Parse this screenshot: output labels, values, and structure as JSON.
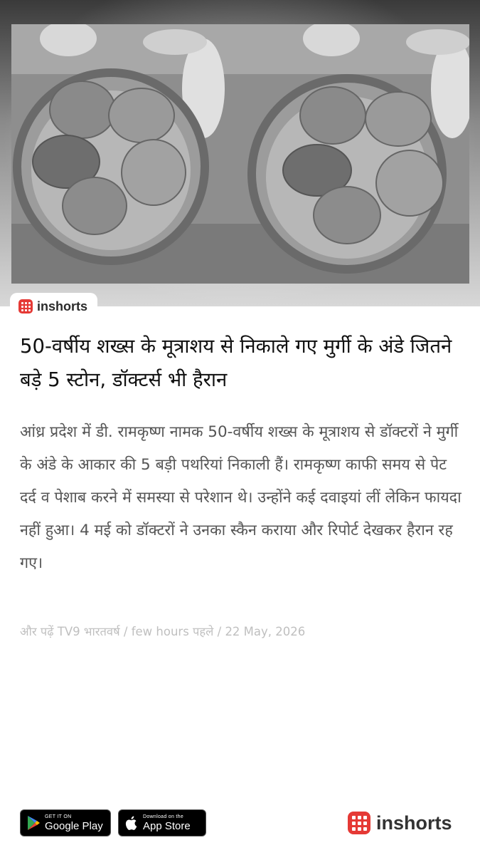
{
  "brand": {
    "name": "inshorts",
    "logo_color": "#e53935"
  },
  "hero": {
    "image_description": "",
    "photo_count": 2
  },
  "article": {
    "headline": "50-वर्षीय शख्स के मूत्राशय से निकाले गए मुर्गी के अंडे जितने बड़े 5 स्टोन, डॉक्टर्स भी हैरान",
    "body": "आंध्र प्रदेश में डी. रामकृष्ण नामक 50-वर्षीय शख्स के मूत्राशय से डॉक्टरों ने मुर्गी के अंडे के आकार की 5 बड़ी पथरियां निकाली हैं। रामकृष्ण काफी समय से पेट दर्द व पेशाब करने में समस्या से परेशान थे। उन्होंने कई दवाइयां लीं लेकिन फायदा नहीं हुआ। 4 मई को डॉक्टरों ने उनका स्कैन कराया और रिपोर्ट देखकर हैरान रह गए।",
    "read_more_prefix": "और पढ़ें",
    "source_name": "TV9 भारतवर्ष",
    "time_ago": "few hours पहले",
    "date": "22 May, 2026"
  },
  "footer": {
    "google_play": {
      "small": "GET IT ON",
      "big": "Google Play"
    },
    "app_store": {
      "small": "Download on the",
      "big": "App Store"
    },
    "brand_text": "inshorts"
  }
}
